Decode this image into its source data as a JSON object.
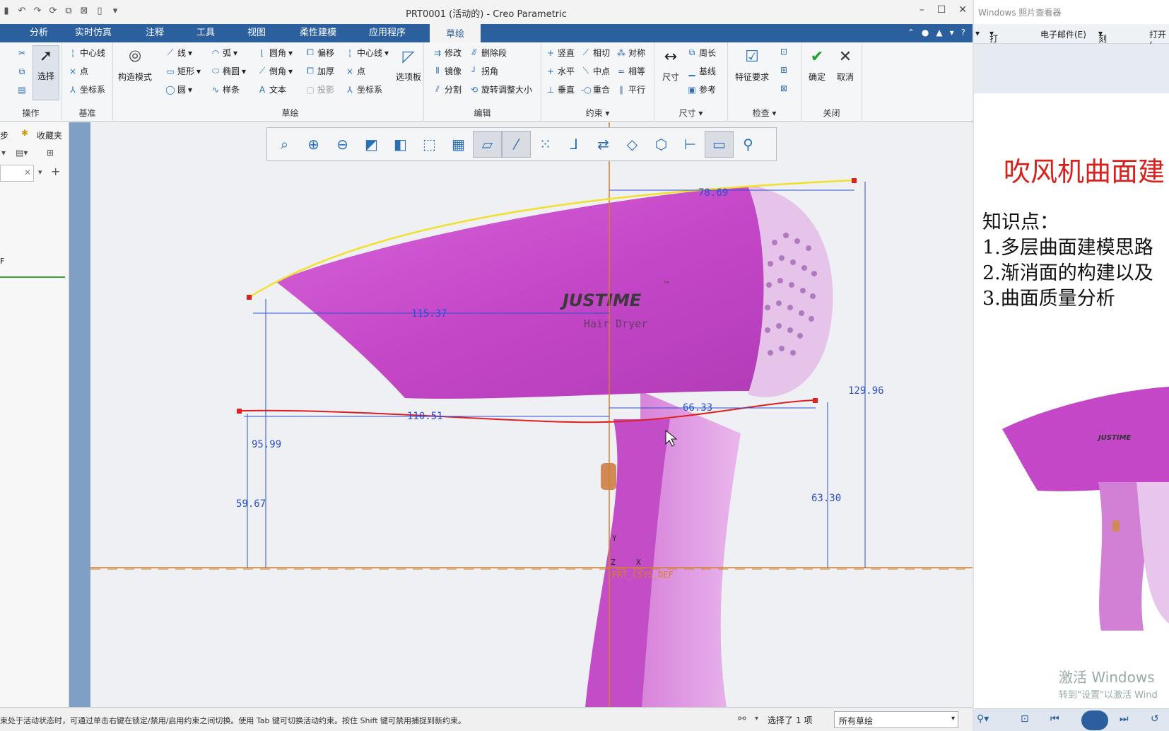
{
  "window": {
    "title": "PRT0001 (活动的) - Creo Parametric",
    "min": "–",
    "max": "☐",
    "close": "✕"
  },
  "ribbon_tabs": [
    "分析",
    "实时仿真",
    "注释",
    "工具",
    "视图",
    "柔性建模",
    "应用程序",
    "草绘"
  ],
  "groups": {
    "operations": {
      "label": "操作",
      "select": "选择"
    },
    "datum": {
      "label": "基准",
      "items": [
        "中心线",
        "点",
        "坐标系"
      ]
    },
    "construction": {
      "label": "构造模式"
    },
    "sketch": {
      "label": "草绘",
      "col1": [
        "线",
        "矩形",
        "圆"
      ],
      "col2": [
        "弧",
        "椭圆",
        "样条"
      ],
      "col3": [
        "圆角",
        "倒角",
        "文本"
      ],
      "col4": [
        "偏移",
        "加厚",
        "投影"
      ],
      "col5": [
        "中心线",
        "点",
        "坐标系"
      ],
      "palette": "选项板"
    },
    "edit": {
      "label": "编辑",
      "col1": [
        "修改",
        "镜像",
        "分割"
      ],
      "col2": [
        "删除段",
        "拐角",
        "旋转调整大小"
      ]
    },
    "constraint": {
      "label": "约束",
      "col1": [
        "竖直",
        "水平",
        "垂直"
      ],
      "col2": [
        "相切",
        "中点",
        "重合"
      ],
      "col3": [
        "对称",
        "相等",
        "平行"
      ]
    },
    "dimension": {
      "label": "尺寸",
      "big": "尺寸",
      "items": [
        "周长",
        "基线",
        "参考"
      ]
    },
    "inspect": {
      "label": "检查",
      "big": "特征要求"
    },
    "close": {
      "label": "关闭",
      "ok": "确定",
      "cancel": "取消"
    }
  },
  "left_panel": {
    "favorites": "收藏夹",
    "stub1": "步",
    "stub2": "F"
  },
  "sketch": {
    "dims": [
      "78.69",
      "115.37",
      "110.51",
      "66.33",
      "129.96",
      "95.99",
      "59.67",
      "63.30"
    ],
    "csys": "PRT_CSYS_DEF",
    "axis_y": "Y",
    "axis_z": "Z",
    "axis_x": "X",
    "brand": "JUSTIME",
    "tm": "™",
    "product": "Hair Dryer"
  },
  "status": {
    "message": "束处于活动状态时，可通过单击右键在锁定/禁用/启用约束之间切换。使用 Tab 键可切换活动约束。按住 Shift 键可禁用捕捉到新约束。",
    "selected": "选择了 1 项",
    "filter": "所有草绘"
  },
  "viewer": {
    "title": "Windows 照片查看器",
    "menu": [
      "打印(P)",
      "电子邮件(E)",
      "刻录(U)",
      "打开("
    ],
    "slide_title": "吹风机曲面建",
    "kp_title": "知识点：",
    "kp": [
      "1.多层曲面建模思路",
      "2.渐消面的构建以及",
      "3.曲面质量分析"
    ],
    "brand": "JUSTIME",
    "watermark1": "激活 Windows",
    "watermark2": "转到\"设置\"以激活 Wind"
  },
  "colors": {
    "ribbon_blue": "#2c5f9e",
    "dryer": "#c447c8",
    "curve_red": "#e02020",
    "curve_yellow": "#f1e12a",
    "dim_blue": "#2b4fd0"
  }
}
